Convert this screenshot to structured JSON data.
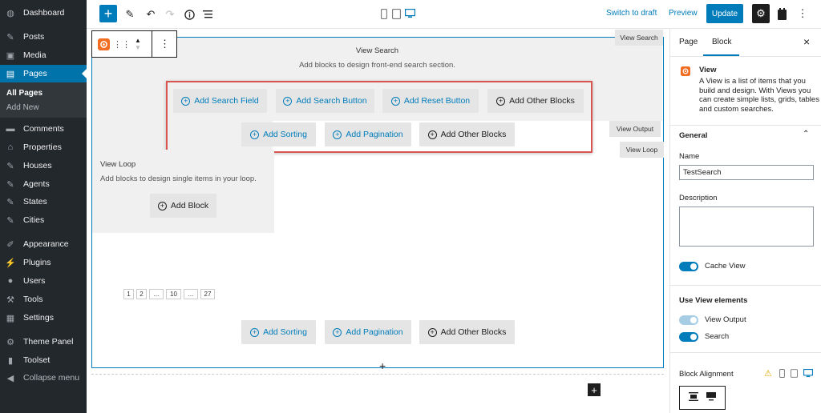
{
  "admin_menu": {
    "items": [
      {
        "label": "Dashboard",
        "icon": "dashboard-icon",
        "glyph": "◍"
      },
      {
        "label": "Posts",
        "icon": "pin-icon",
        "glyph": "✎"
      },
      {
        "label": "Media",
        "icon": "media-icon",
        "glyph": "▣"
      },
      {
        "label": "Pages",
        "icon": "pages-icon",
        "glyph": "▤"
      },
      {
        "label": "Comments",
        "icon": "comments-icon",
        "glyph": "▬"
      },
      {
        "label": "Properties",
        "icon": "properties-icon",
        "glyph": "⌂"
      },
      {
        "label": "Houses",
        "icon": "pin-icon",
        "glyph": "✎"
      },
      {
        "label": "Agents",
        "icon": "pin-icon",
        "glyph": "✎"
      },
      {
        "label": "States",
        "icon": "pin-icon",
        "glyph": "✎"
      },
      {
        "label": "Cities",
        "icon": "pin-icon",
        "glyph": "✎"
      },
      {
        "label": "Appearance",
        "icon": "appearance-icon",
        "glyph": "✐"
      },
      {
        "label": "Plugins",
        "icon": "plugins-icon",
        "glyph": "⚡"
      },
      {
        "label": "Users",
        "icon": "users-icon",
        "glyph": "●"
      },
      {
        "label": "Tools",
        "icon": "tools-icon",
        "glyph": "⚒"
      },
      {
        "label": "Settings",
        "icon": "settings-icon",
        "glyph": "▦"
      },
      {
        "label": "Theme Panel",
        "icon": "gear-icon",
        "glyph": "⚙"
      },
      {
        "label": "Toolset",
        "icon": "toolset-icon",
        "glyph": "▮"
      },
      {
        "label": "Collapse menu",
        "icon": "collapse-icon",
        "glyph": "◀"
      }
    ],
    "submenu": {
      "all_pages": "All Pages",
      "add_new": "Add New"
    }
  },
  "header": {
    "switch_to_draft": "Switch to draft",
    "preview": "Preview",
    "update": "Update"
  },
  "canvas": {
    "search_title": "View Search",
    "search_desc": "Add blocks to design front-end search section.",
    "search_buttons": {
      "add_search_field": "Add Search Field",
      "add_search_button": "Add Search Button",
      "add_reset_button": "Add Reset Button",
      "add_other_blocks": "Add Other Blocks",
      "add_sorting": "Add Sorting",
      "add_pagination": "Add Pagination",
      "add_other_blocks_2": "Add Other Blocks"
    },
    "labels": {
      "view_search": "View Search",
      "view_output": "View Output",
      "view_loop": "View Loop"
    },
    "loop_title": "View Loop",
    "loop_desc": "Add blocks to design single items in your loop.",
    "add_block": "Add Block",
    "pagination": [
      "1",
      "2",
      "...",
      "10",
      "...",
      "27"
    ],
    "bottom_buttons": {
      "add_sorting": "Add Sorting",
      "add_pagination": "Add Pagination",
      "add_other_blocks": "Add Other Blocks"
    },
    "plus": "+"
  },
  "sidebar": {
    "tab_page": "Page",
    "tab_block": "Block",
    "close": "×",
    "block_name": "View",
    "block_desc": "A View is a list of items that you build and design. With Views you can create simple lists, grids, tables and custom searches.",
    "general": "General",
    "name_label": "Name",
    "name_value": "TestSearch",
    "description_label": "Description",
    "description_value": "",
    "cache_view": "Cache View",
    "use_view_elements": "Use View elements",
    "view_output": "View Output",
    "search": "Search",
    "block_alignment": "Block Alignment"
  },
  "colors": {
    "accent": "#007cba",
    "admin_bg": "#23282d",
    "highlight": "#d9534f",
    "brand_orange": "#f26d21"
  }
}
